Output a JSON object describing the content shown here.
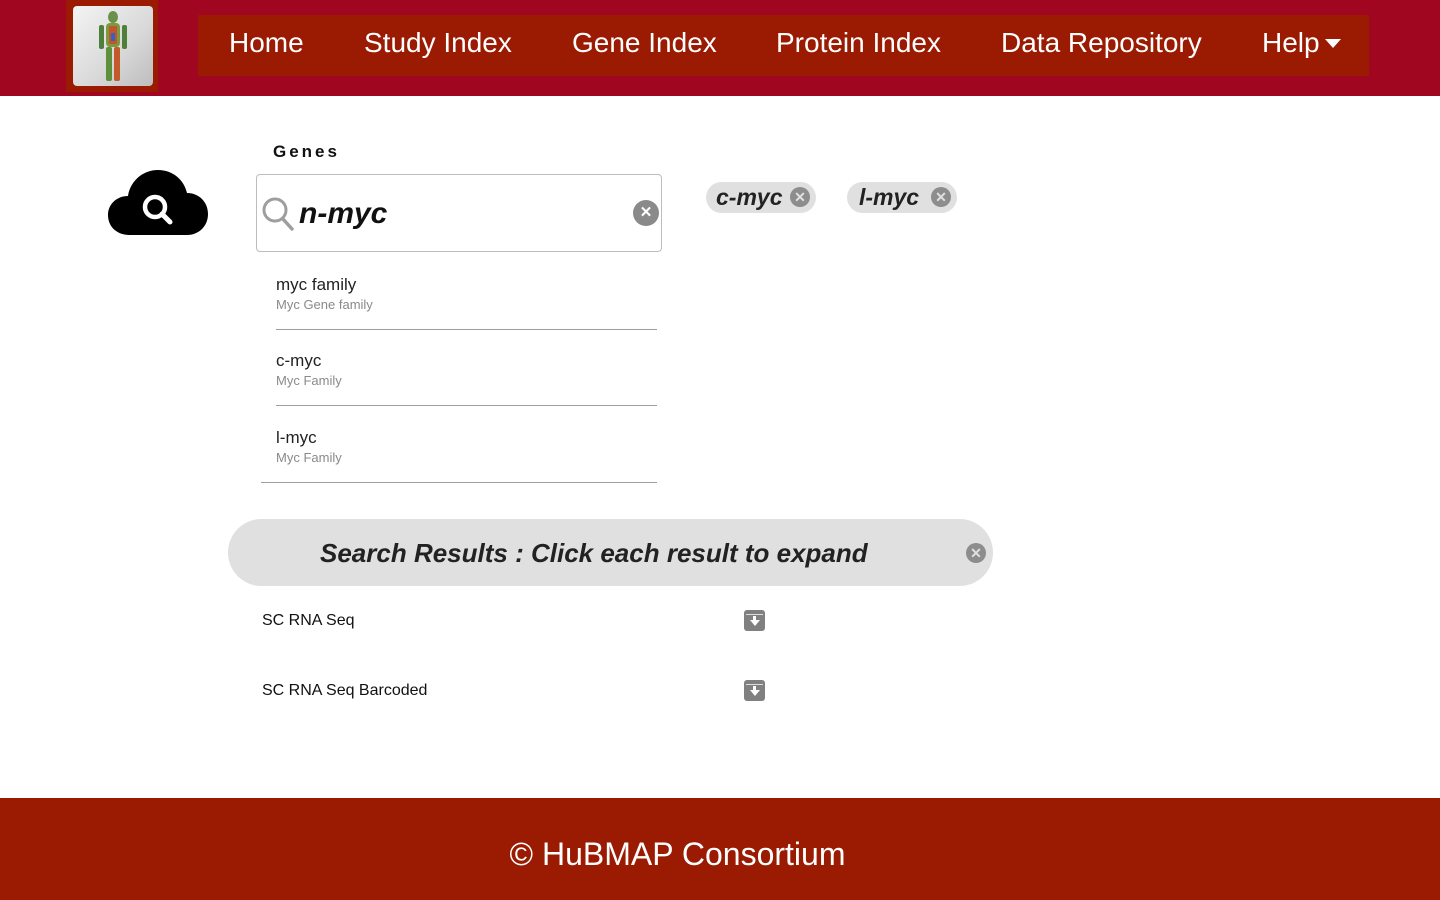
{
  "header": {
    "logo_icon": "human-body-atlas-logo",
    "nav": [
      {
        "label": "Home"
      },
      {
        "label": "Study Index"
      },
      {
        "label": "Gene Index"
      },
      {
        "label": "Protein Index"
      },
      {
        "label": "Data Repository"
      },
      {
        "label": "Help"
      }
    ],
    "colors": {
      "bar": "#a0061f",
      "nav": "#9a1a02"
    }
  },
  "search": {
    "icon": "cloud-search-icon",
    "field_label": "Genes",
    "query": "n-myc",
    "clear_icon": "close-icon",
    "suggestions": [
      {
        "title": "myc family",
        "subtitle": "Myc Gene family"
      },
      {
        "title": "c-myc",
        "subtitle": "Myc Family"
      },
      {
        "title": "l-myc",
        "subtitle": "Myc Family"
      }
    ],
    "chips": [
      {
        "label": "c-myc"
      },
      {
        "label": "l-myc"
      }
    ]
  },
  "results": {
    "banner": "Search Results : Click each result to expand",
    "items": [
      {
        "label": "SC RNA Seq",
        "icon": "expand-archive-icon"
      },
      {
        "label": "SC RNA Seq Barcoded",
        "icon": "expand-archive-icon"
      }
    ]
  },
  "footer": {
    "text": "© HuBMAP Consortium"
  }
}
